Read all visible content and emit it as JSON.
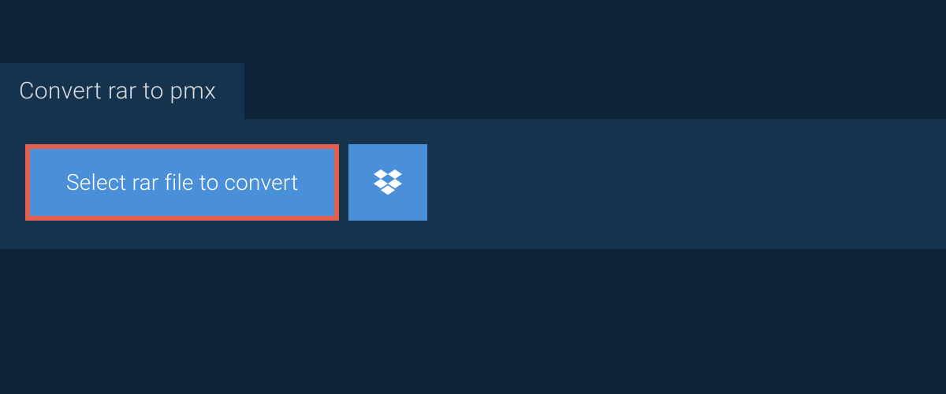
{
  "tab": {
    "title": "Convert rar to pmx"
  },
  "actions": {
    "select_file_label": "Select rar file to convert"
  }
}
